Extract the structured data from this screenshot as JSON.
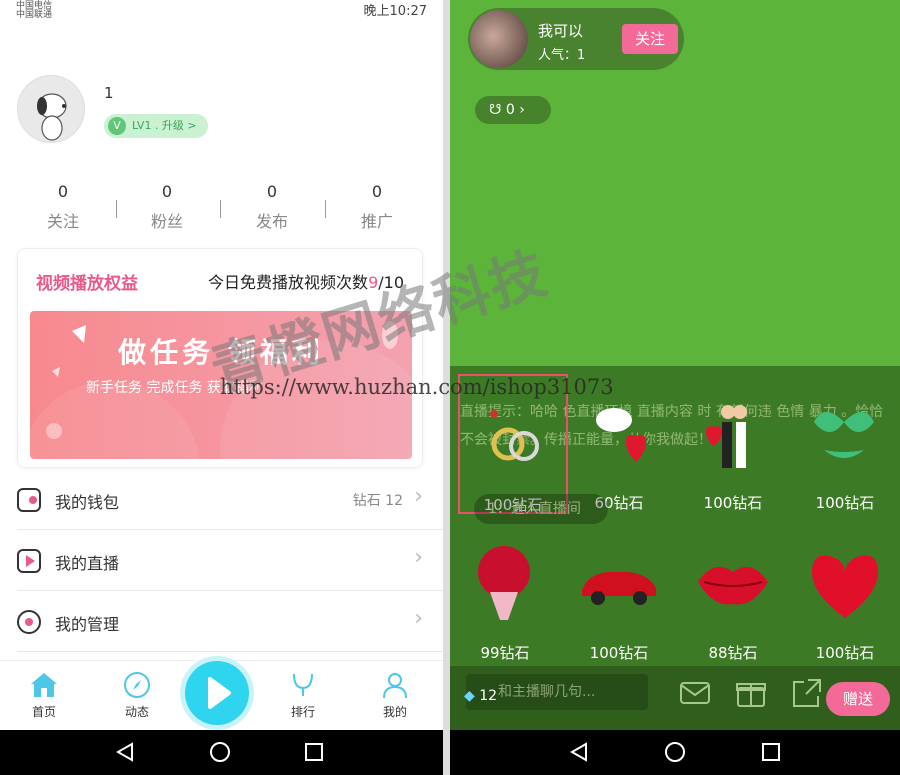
{
  "left": {
    "status": {
      "carrier1": "中国电信",
      "carrier2": "中国联通",
      "time": "晚上10:27"
    },
    "user": {
      "name": "1",
      "level": "LV1 . 升级 >",
      "level_icon": "V"
    },
    "stats": [
      {
        "value": "0",
        "label": "关注"
      },
      {
        "value": "0",
        "label": "粉丝"
      },
      {
        "value": "0",
        "label": "发布"
      },
      {
        "value": "0",
        "label": "推广"
      }
    ],
    "card": {
      "title": "视频播放权益",
      "count_label": "今日免费播放视频次数",
      "count_used": "9",
      "count_total": "/10",
      "banner_big": "做任务 领福利",
      "banner_small": "新手任务  完成任务 获取福利"
    },
    "menu": [
      {
        "label": "我的钱包",
        "value": "钻石 12"
      },
      {
        "label": "我的直播",
        "value": ""
      },
      {
        "label": "我的管理",
        "value": ""
      }
    ],
    "tabs": [
      {
        "label": "首页"
      },
      {
        "label": "动态"
      },
      {
        "label": "排行"
      },
      {
        "label": "我的"
      }
    ]
  },
  "right": {
    "host": {
      "name": "我可以",
      "popularity": "人气：1",
      "follow": "关注"
    },
    "coin": {
      "value": "0",
      "arrow": "›"
    },
    "chat_notice": "直播提示：哈哈 色直播环境 直播内容 时 有任何违 色情 暴力 。恰恰不会被封禁。传播正能量，从你我做起！",
    "enter_notice": "1：进入直播间",
    "gifts": [
      {
        "price": "100钻石",
        "icon": "rings-icon",
        "selected": true
      },
      {
        "price": "60钻石",
        "icon": "dove-heart-icon",
        "selected": false
      },
      {
        "price": "100钻石",
        "icon": "kiss-couple-icon",
        "selected": false
      },
      {
        "price": "100钻石",
        "icon": "bikini-icon",
        "selected": false
      },
      {
        "price": "99钻石",
        "icon": "rose-bouquet-icon",
        "selected": false
      },
      {
        "price": "100钻石",
        "icon": "sports-car-icon",
        "selected": false
      },
      {
        "price": "88钻石",
        "icon": "lips-icon",
        "selected": false
      },
      {
        "price": "100钻石",
        "icon": "diamond-heart-icon",
        "selected": false
      }
    ],
    "bottom": {
      "placeholder": "和主播聊几句...",
      "diamonds": "12",
      "send": "赠送"
    }
  },
  "watermark": {
    "text": "青橙网络科技",
    "url": "https://www.huzhan.com/ishop31073"
  },
  "colors": {
    "accent_pink": "#f36a98",
    "title_pink": "#e85a8b",
    "play_cyan": "#2fd4ee",
    "live_green": "#5cb53a"
  }
}
